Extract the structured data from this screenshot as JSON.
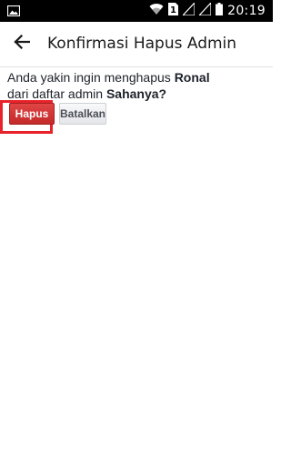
{
  "status_bar": {
    "time": "20:19",
    "sim_label": "1",
    "icons": [
      "image-icon",
      "wifi-icon",
      "sim-icon",
      "signal-icon",
      "signal-icon",
      "battery-icon"
    ]
  },
  "app_bar": {
    "title": "Konfirmasi Hapus Admin",
    "back_icon": "back-arrow-icon"
  },
  "dialog": {
    "line1_prefix": "Anda yakin ingin menghapus ",
    "line1_name": "Ronal",
    "line2_prefix": "dari daftar admin ",
    "line2_page": "Sahanya?",
    "confirm_label": "Hapus",
    "cancel_label": "Batalkan"
  },
  "colors": {
    "confirm_button": "#d43535",
    "highlight_border": "#e8222b",
    "cancel_button": "#eff0f2"
  }
}
